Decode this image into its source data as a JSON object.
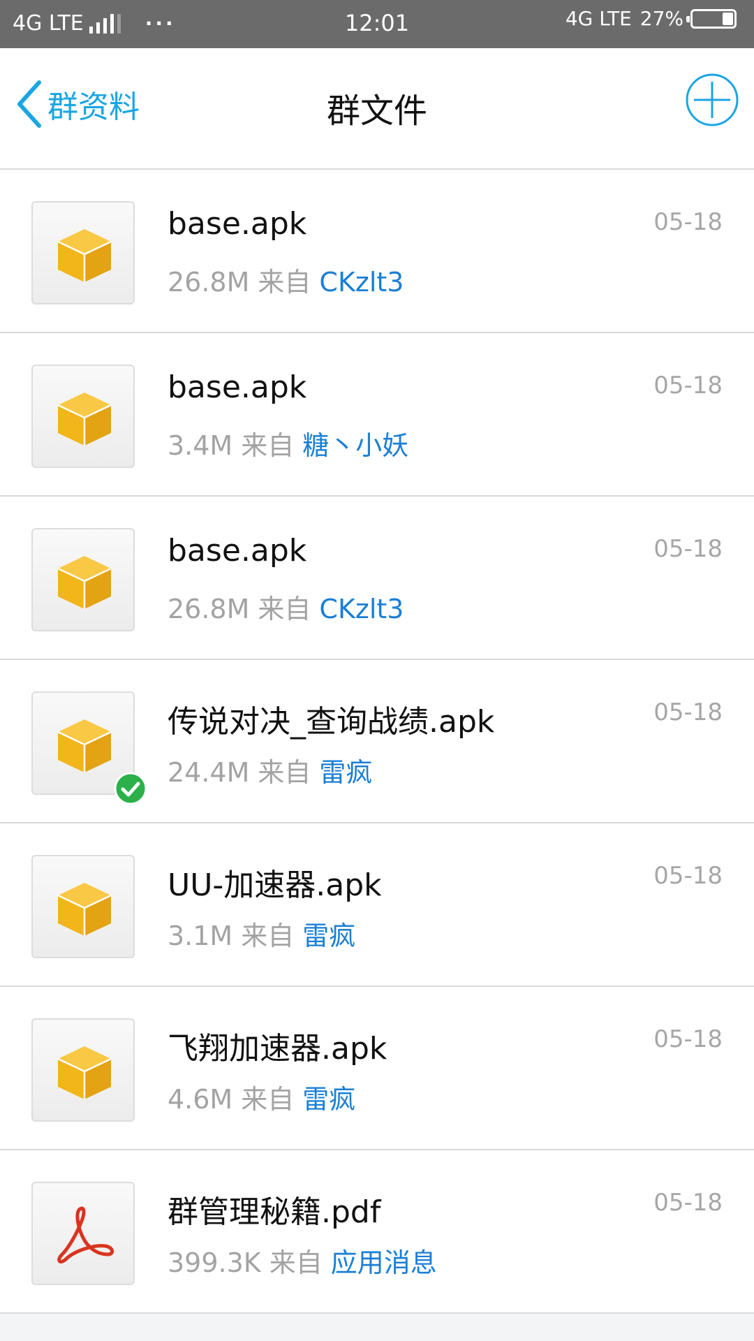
{
  "status_bar": {
    "left_network": "4G LTE",
    "dots": "···",
    "time": "12:01",
    "right_network": "4G LTE",
    "battery_percent": "27%",
    "battery_level": 0.27
  },
  "header": {
    "back_label": "群资料",
    "title": "群文件"
  },
  "labels": {
    "from": "来自"
  },
  "files": [
    {
      "name": "base.apk",
      "size": "26.8M",
      "uploader": "CKzlt3",
      "date": "05-18",
      "icon": "apk-package-icon",
      "downloaded": false
    },
    {
      "name": "base.apk",
      "size": "3.4M",
      "uploader": "糖丶小妖",
      "date": "05-18",
      "icon": "apk-package-icon",
      "downloaded": false
    },
    {
      "name": "base.apk",
      "size": "26.8M",
      "uploader": "CKzlt3",
      "date": "05-18",
      "icon": "apk-package-icon",
      "downloaded": false
    },
    {
      "name": "传说对决_查询战绩.apk",
      "size": "24.4M",
      "uploader": "雷疯",
      "date": "05-18",
      "icon": "apk-package-icon",
      "downloaded": true
    },
    {
      "name": "UU-加速器.apk",
      "size": "3.1M",
      "uploader": "雷疯",
      "date": "05-18",
      "icon": "apk-package-icon",
      "downloaded": false
    },
    {
      "name": "飞翔加速器.apk",
      "size": "4.6M",
      "uploader": "雷疯",
      "date": "05-18",
      "icon": "apk-package-icon",
      "downloaded": false
    },
    {
      "name": "群管理秘籍.pdf",
      "size": "399.3K",
      "uploader": "应用消息",
      "date": "05-18",
      "icon": "pdf-icon",
      "downloaded": false
    }
  ],
  "colors": {
    "accent": "#1aa5e4",
    "uploader": "#1a7fd6",
    "package": "#f2b51a",
    "pdf": "#d9341f",
    "check": "#2bb04a"
  }
}
